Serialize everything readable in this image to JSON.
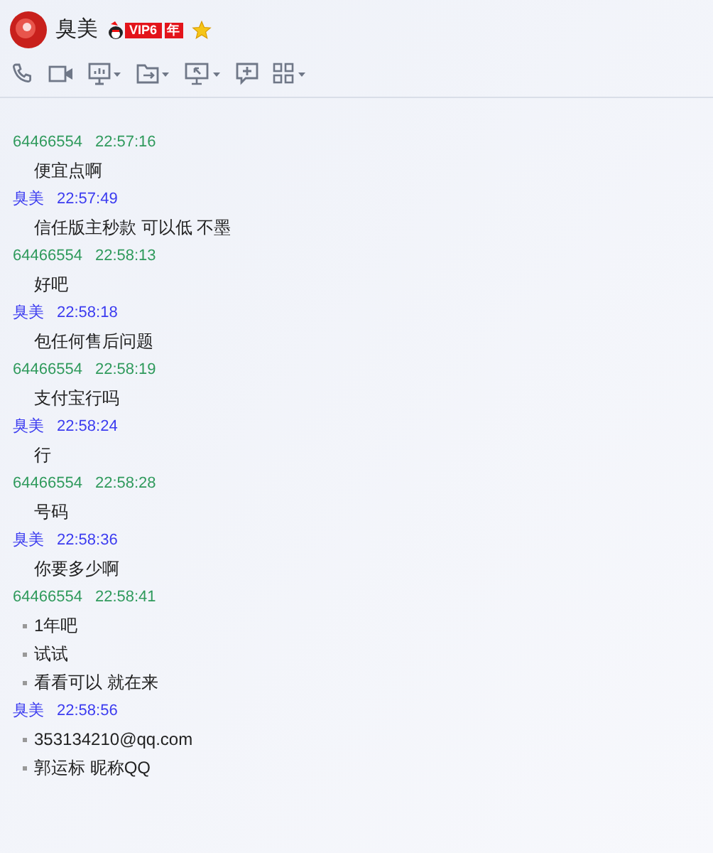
{
  "contact": {
    "name": "臭美",
    "vip_label": "VIP6",
    "year_label": "年"
  },
  "messages": [
    {
      "sender": "64466554",
      "time": "22:57:16",
      "kind": "peer",
      "lines": [
        "便宜点啊"
      ]
    },
    {
      "sender": "臭美",
      "time": "22:57:49",
      "kind": "self",
      "lines": [
        "信任版主秒款 可以低  不墨"
      ]
    },
    {
      "sender": "64466554",
      "time": "22:58:13",
      "kind": "peer",
      "lines": [
        "好吧"
      ]
    },
    {
      "sender": "臭美",
      "time": "22:58:18",
      "kind": "self",
      "lines": [
        "包任何售后问题"
      ]
    },
    {
      "sender": "64466554",
      "time": "22:58:19",
      "kind": "peer",
      "lines": [
        "支付宝行吗"
      ]
    },
    {
      "sender": "臭美",
      "time": "22:58:24",
      "kind": "self",
      "lines": [
        "行"
      ]
    },
    {
      "sender": "64466554",
      "time": "22:58:28",
      "kind": "peer",
      "lines": [
        "号码"
      ]
    },
    {
      "sender": "臭美",
      "time": "22:58:36",
      "kind": "self",
      "lines": [
        "你要多少啊"
      ]
    },
    {
      "sender": "64466554",
      "time": "22:58:41",
      "kind": "peer",
      "lines": [
        "1年吧",
        "试试",
        "看看可以 就在来"
      ]
    },
    {
      "sender": "臭美",
      "time": "22:58:56",
      "kind": "self",
      "lines": [
        "353134210@qq.com",
        "郭运标  昵称QQ"
      ]
    }
  ]
}
